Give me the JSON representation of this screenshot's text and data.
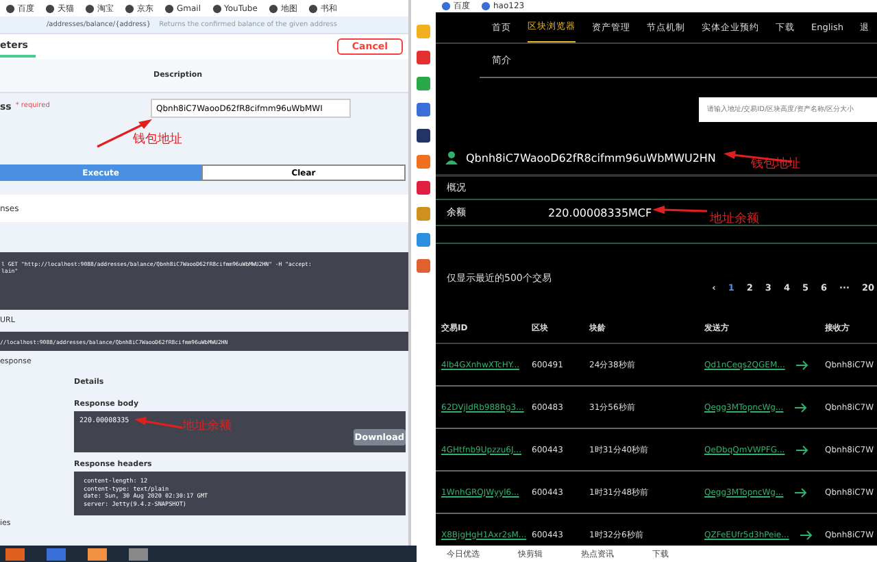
{
  "left_pane": {
    "bookmarks": [
      "百度",
      "天猫",
      "淘宝",
      "京东",
      "Gmail",
      "YouTube",
      "地图",
      "书和"
    ],
    "endpoint": {
      "path": "/addresses/balance/{address}",
      "summary": "Returns the confirmed balance of the given address"
    },
    "tab": "eters",
    "cancel_button": "Cancel",
    "description_header": "Description",
    "parameter": {
      "name": "ss",
      "required": "* required",
      "value": "Qbnh8iC7WaooD62fR8cifmm96uWbMWI"
    },
    "annotation_wallet": "钱包地址",
    "execute_button": "Execute",
    "clear_button": "Clear",
    "responses_label": "nses",
    "curl": [
      "l GET \"http://localhost:9088/addresses/balance/Qbnh8iC7WaooD62fR8cifmm96uWbMWU2HN\" -H \"accept:",
      "lain\""
    ],
    "url_label": "URL",
    "request_url": "//localhost:9088/addresses/balance/Qbnh8iC7WaooD62fR8cifmm96uWbMWU2HN",
    "response_label": "esponse",
    "details_label": "Details",
    "body_label": "Response body",
    "body": "220.00008335",
    "annotation_balance": "地址余额",
    "download_button": "Download",
    "headers_label": "Response headers",
    "headers": [
      "content-length: 12",
      "content-type: text/plain",
      "date: Sun, 30 Aug 2020 02:30:17 GMT",
      "server: Jetty(9.4.z-SNAPSHOT)"
    ],
    "footer_label": "ies"
  },
  "right_pane": {
    "bookmarks": [
      "百度",
      "hao123"
    ],
    "nav": [
      {
        "label": "首页",
        "selected": false
      },
      {
        "label": "区块浏览器",
        "selected": true
      },
      {
        "label": "资产管理",
        "selected": false
      },
      {
        "label": "节点机制",
        "selected": false
      },
      {
        "label": "实体企业预约",
        "selected": false
      },
      {
        "label": "下载",
        "selected": false
      },
      {
        "label": "English",
        "selected": false
      },
      {
        "label": "退",
        "selected": false
      }
    ],
    "sub_nav": "简介",
    "search": {
      "placeholder": "请输入地址/交易ID/区块高度/资产名称/区分大小"
    },
    "address": "Qbnh8iC7WaooD62fR8cifmm96uWbMWU2HN",
    "annotation_wallet": "钱包地址",
    "overview_label": "概况",
    "balance_label": "余额",
    "balance": "220.00008335MCF",
    "annotation_balance": "地址余额",
    "tx_note": "仅显示最近的500个交易",
    "pagination": [
      {
        "label": "‹",
        "selected": false
      },
      {
        "label": "1",
        "selected": true
      },
      {
        "label": "2",
        "selected": false
      },
      {
        "label": "3",
        "selected": false
      },
      {
        "label": "4",
        "selected": false
      },
      {
        "label": "5",
        "selected": false
      },
      {
        "label": "6",
        "selected": false
      },
      {
        "label": "···",
        "selected": false
      },
      {
        "label": "20",
        "selected": false
      }
    ],
    "table": {
      "columns": [
        "交易ID",
        "区块",
        "块龄",
        "发送方",
        "接收方"
      ],
      "rows": [
        {
          "id": "4lb4GXnhwXTcHY...",
          "block": "600491",
          "age": "24分38秒前",
          "sender": "Qd1nCeqs2QGEM...",
          "receiver": "Qbnh8iC7W"
        },
        {
          "id": "62DVjldRb988Rg3...",
          "block": "600483",
          "age": "31分56秒前",
          "sender": "Qegg3MTopncWg...",
          "receiver": "Qbnh8iC7W"
        },
        {
          "id": "4GHtfnb9Upzzu6J...",
          "block": "600443",
          "age": "1时31分40秒前",
          "sender": "QeDbqQmVWPFG...",
          "receiver": "Qbnh8iC7W"
        },
        {
          "id": "1WnhGRQJWyyl6...",
          "block": "600443",
          "age": "1时31分48秒前",
          "sender": "Qegg3MTopncWg...",
          "receiver": "Qbnh8iC7W"
        },
        {
          "id": "X8BjgHgH1Axr2sM...",
          "block": "600443",
          "age": "1时32分6秒前",
          "sender": "QZFeEUfr5d3hPeie...",
          "receiver": "Qbnh8iC7W"
        }
      ]
    }
  },
  "status_bar": {
    "items": [
      "今日优选",
      "快剪辑",
      "热点资讯",
      "下载"
    ]
  }
}
